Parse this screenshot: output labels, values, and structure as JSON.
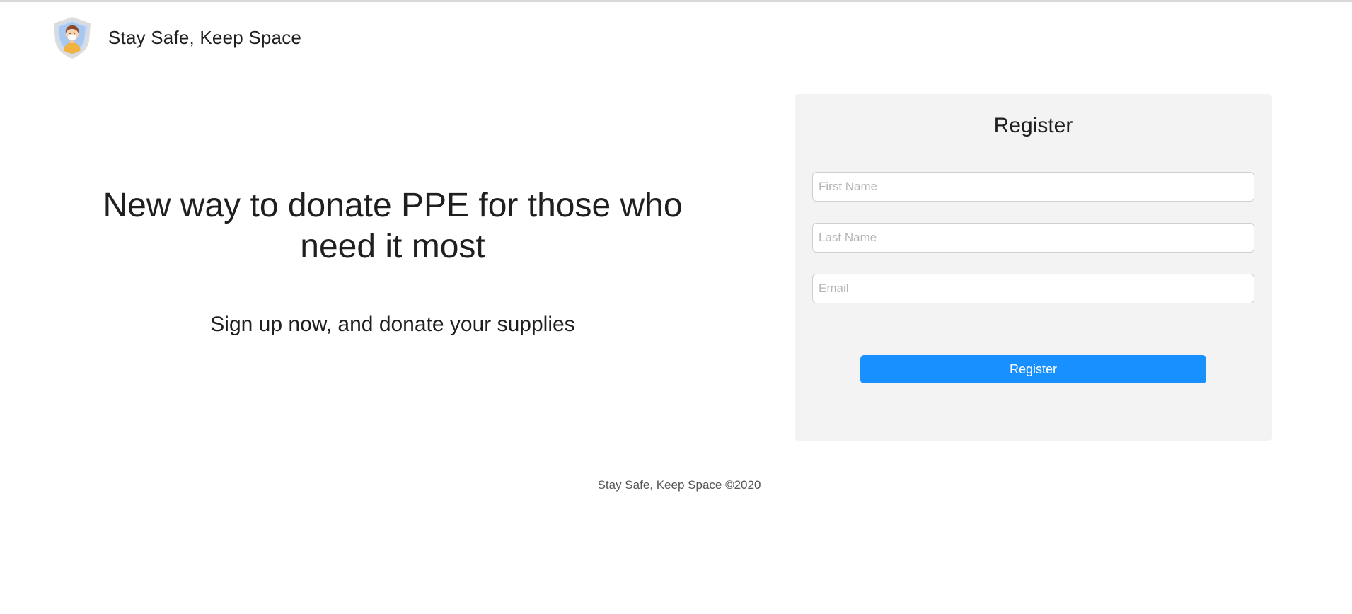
{
  "header": {
    "logo_icon": "shield-person-icon",
    "brand_name": "Stay Safe, Keep Space"
  },
  "hero": {
    "title": "New way to donate PPE for those who need it most",
    "subtitle": "Sign up now, and donate your supplies"
  },
  "register_form": {
    "title": "Register",
    "first_name": {
      "value": "",
      "placeholder": "First Name"
    },
    "last_name": {
      "value": "",
      "placeholder": "Last Name"
    },
    "email": {
      "value": "",
      "placeholder": "Email"
    },
    "submit_label": "Register"
  },
  "footer": {
    "text": "Stay Safe, Keep Space ©2020"
  },
  "colors": {
    "accent": "#1890ff",
    "card_background": "#f3f3f3",
    "text": "#1f1f1f"
  }
}
